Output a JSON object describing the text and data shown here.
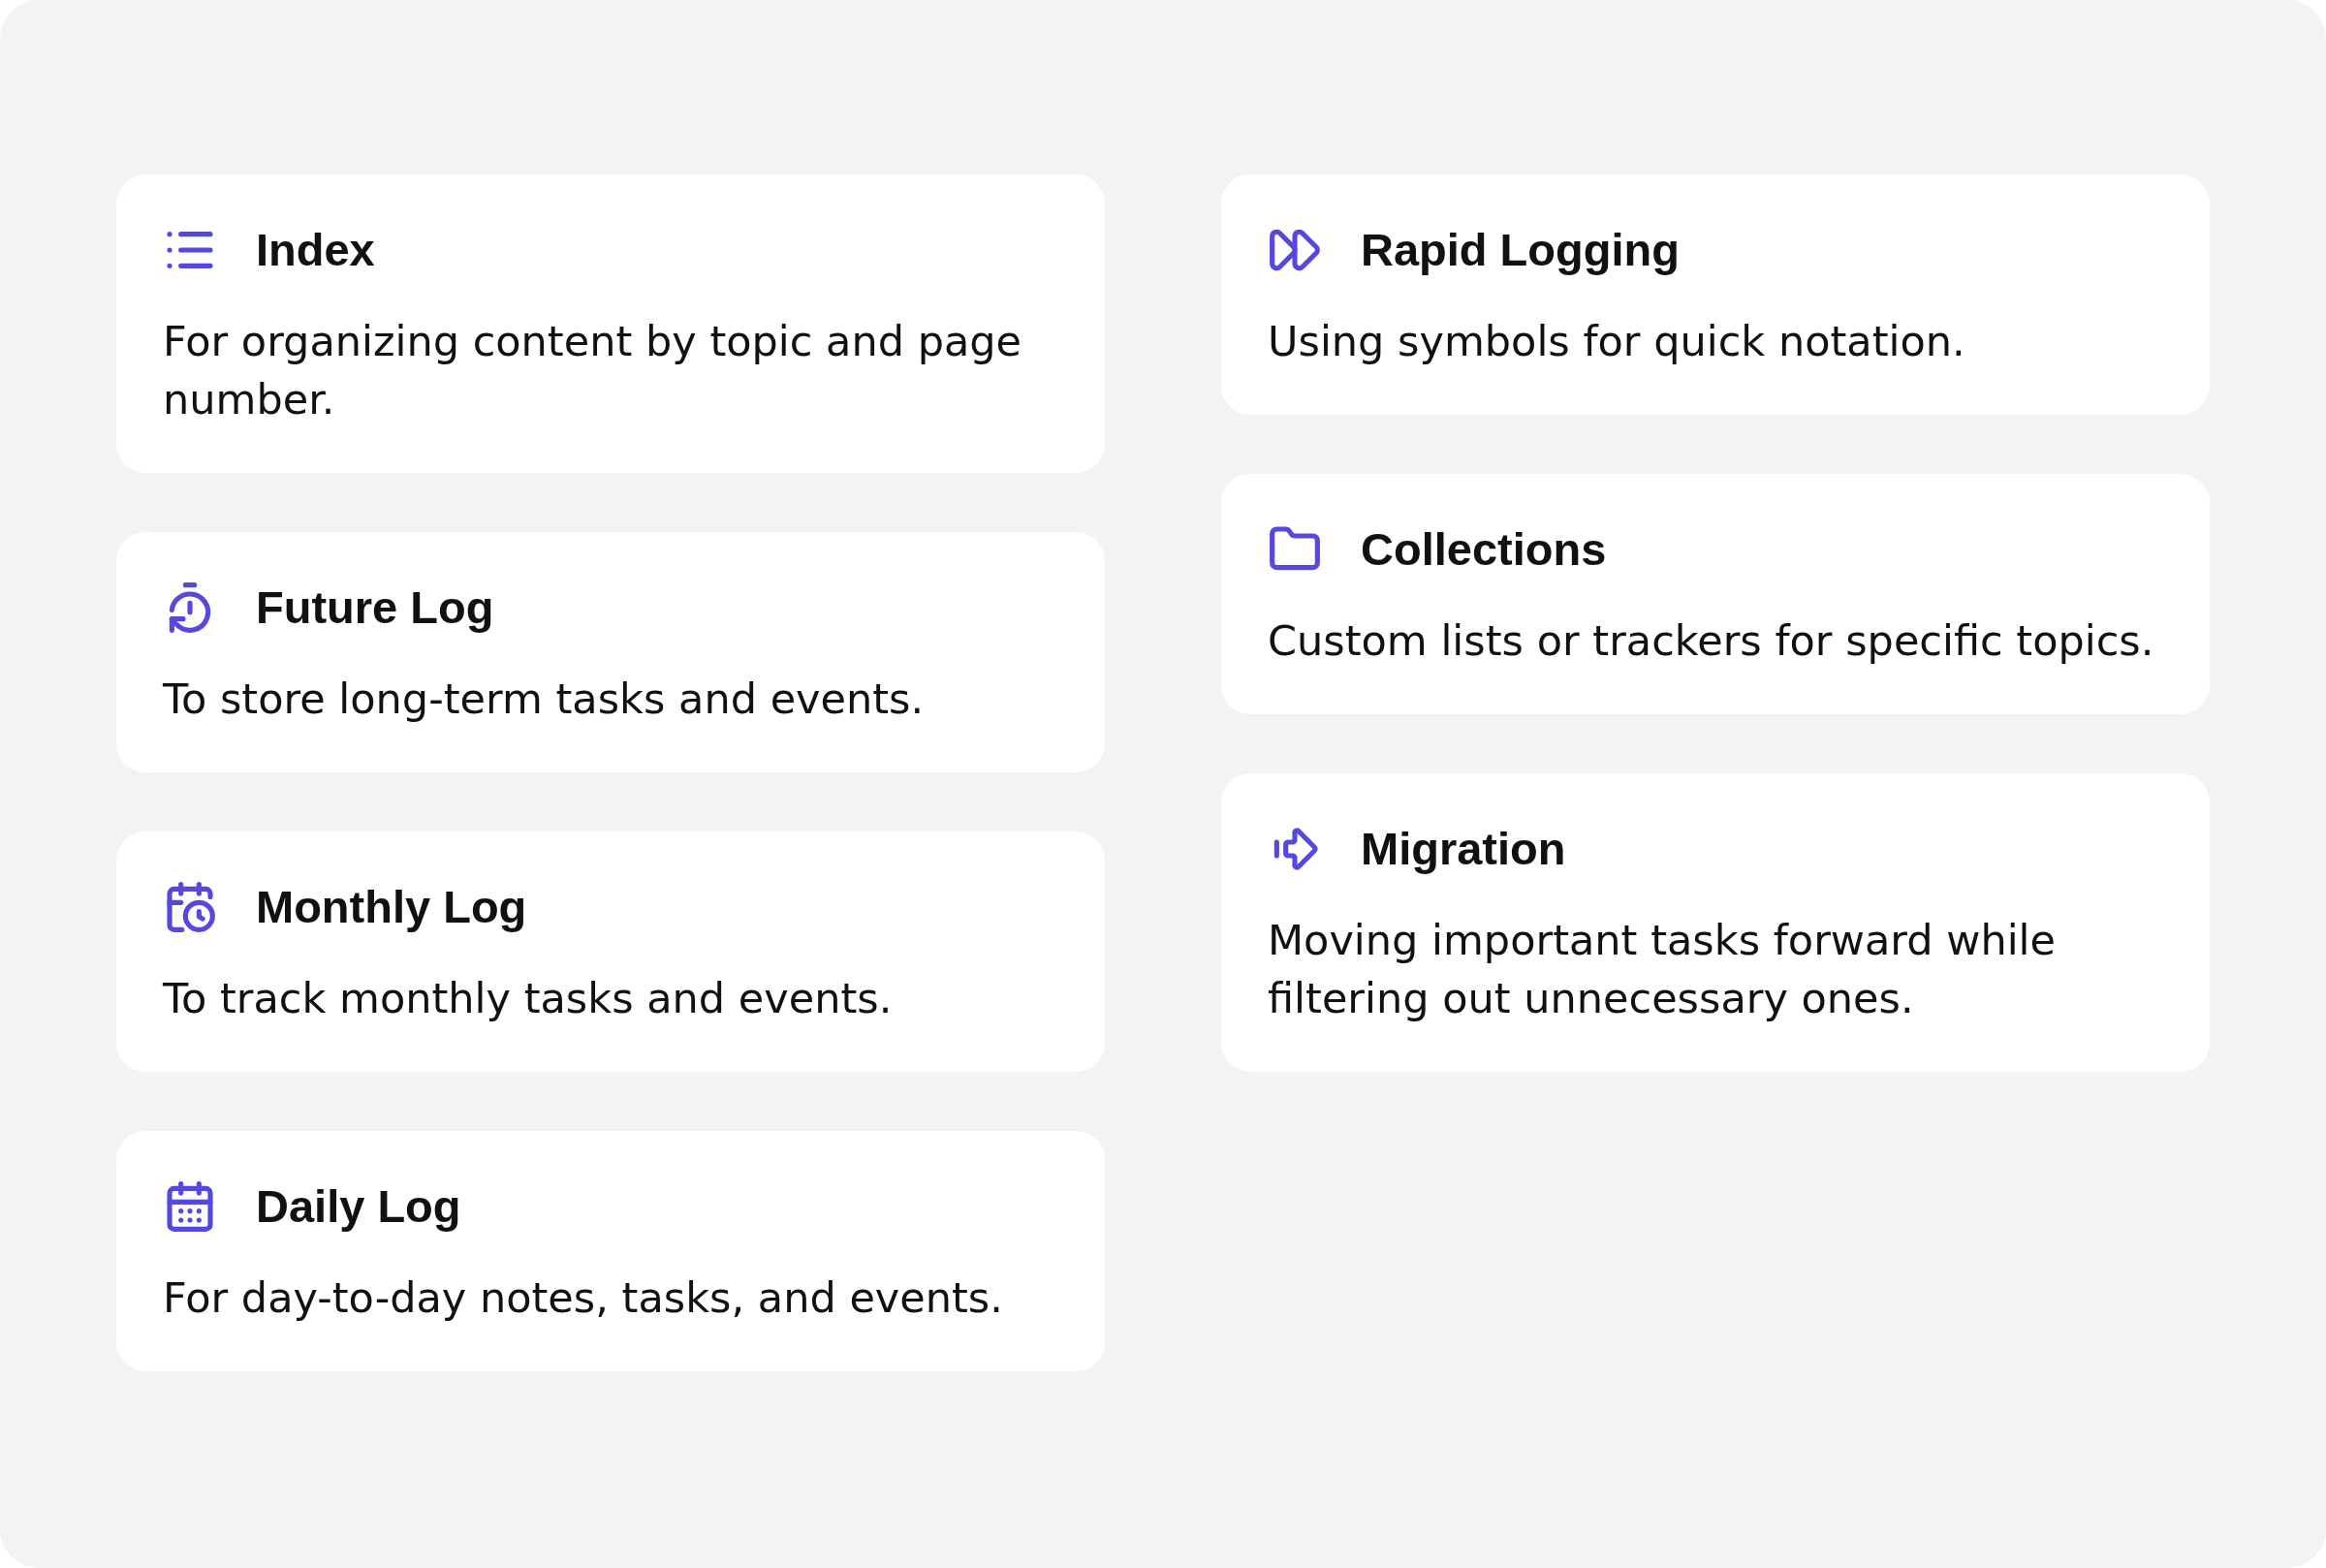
{
  "columns": [
    {
      "cards": [
        {
          "kind": "list",
          "title": "Index",
          "description": "For organizing content by topic and page number."
        },
        {
          "kind": "timer",
          "title": "Future Log",
          "description": "To store long-term tasks and events."
        },
        {
          "kind": "calendar-clock",
          "title": "Monthly Log",
          "description": "To track monthly tasks and events."
        },
        {
          "kind": "calendar",
          "title": "Daily Log",
          "description": "For day-to-day notes, tasks, and events."
        }
      ]
    },
    {
      "cards": [
        {
          "kind": "forward",
          "title": "Rapid Logging",
          "description": "Using symbols for quick notation."
        },
        {
          "kind": "folder",
          "title": "Collections",
          "description": "Custom lists or trackers for specific topics."
        },
        {
          "kind": "arrow",
          "title": "Migration",
          "description": "Moving important tasks forward while filtering out unnecessary ones."
        }
      ]
    }
  ]
}
